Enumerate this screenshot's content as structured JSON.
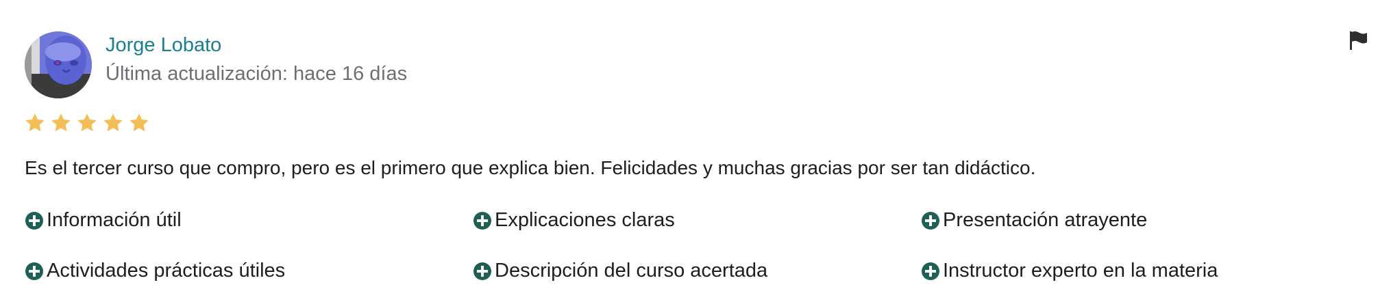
{
  "review": {
    "author_name": "Jorge Lobato",
    "updated_text": "Última actualización: hace 16 días",
    "rating": 5,
    "rating_max": 5,
    "comment": "Es el tercer curso que compro, pero es el primero que explica bien. Felicidades y muchas gracias por ser tan didáctico.",
    "tags": [
      "Información útil",
      "Explicaciones claras",
      "Presentación atrayente",
      "Actividades prácticas útiles",
      "Descripción del curso acertada",
      "Instructor experto en la materia"
    ]
  },
  "colors": {
    "author_link": "#1a7f8e",
    "muted_text": "#6a6f73",
    "star": "#f3be55",
    "tag_plus": "#1e6055",
    "flag": "#2d2f31"
  },
  "icons": {
    "flag": "flag-icon",
    "star": "star-icon",
    "tag": "plus-circle-icon"
  }
}
